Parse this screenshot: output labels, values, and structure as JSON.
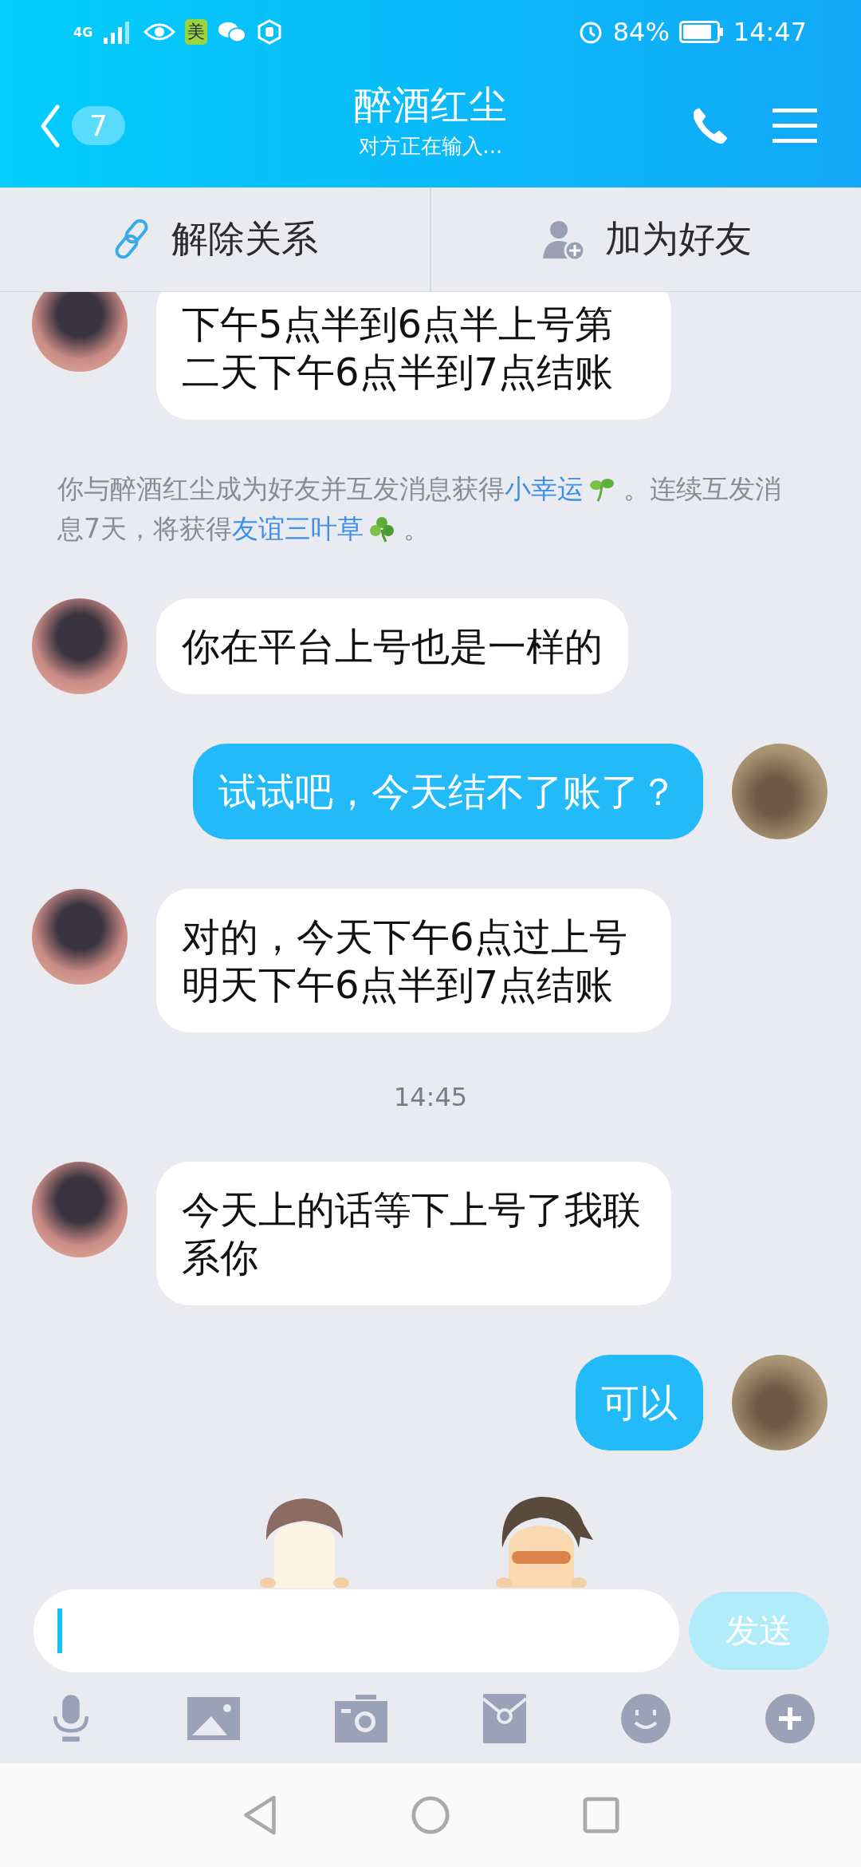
{
  "status_bar": {
    "network": "4G",
    "app_badge": "美",
    "battery_text": "84%",
    "time": "14:47"
  },
  "header": {
    "unread_count": "7",
    "title": "醉酒红尘",
    "subtitle": "对方正在输入..."
  },
  "actions": [
    {
      "kind": "unlink",
      "label": "解除关系"
    },
    {
      "kind": "add_friend",
      "label": "加为好友"
    }
  ],
  "chat": [
    {
      "kind": "received",
      "text": "下午5点半到6点半上号第二天下午6点半到7点结账"
    },
    {
      "kind": "notice",
      "parts": [
        {
          "kind": "text",
          "text": "你与醉酒红尘成为好友并互发消息获得"
        },
        {
          "kind": "link",
          "text": "小幸运"
        },
        {
          "kind": "sprout"
        },
        {
          "kind": "text",
          "text": " 。连续互发消息7天，将获得"
        },
        {
          "kind": "link",
          "text": "友谊三叶草"
        },
        {
          "kind": "clover"
        },
        {
          "kind": "text",
          "text": " 。"
        }
      ]
    },
    {
      "kind": "received",
      "text": "你在平台上号也是一样的"
    },
    {
      "kind": "sent",
      "text": "试试吧，今天结不了账了？"
    },
    {
      "kind": "received",
      "text": "对的，今天下午6点过上号明天下午6点半到7点结账"
    },
    {
      "kind": "time",
      "text": "14:45"
    },
    {
      "kind": "received",
      "text": "今天上的话等下上号了我联系你"
    },
    {
      "kind": "sent",
      "text": "可以"
    }
  ],
  "composer": {
    "send_label": "发送",
    "send_disabled": true
  }
}
